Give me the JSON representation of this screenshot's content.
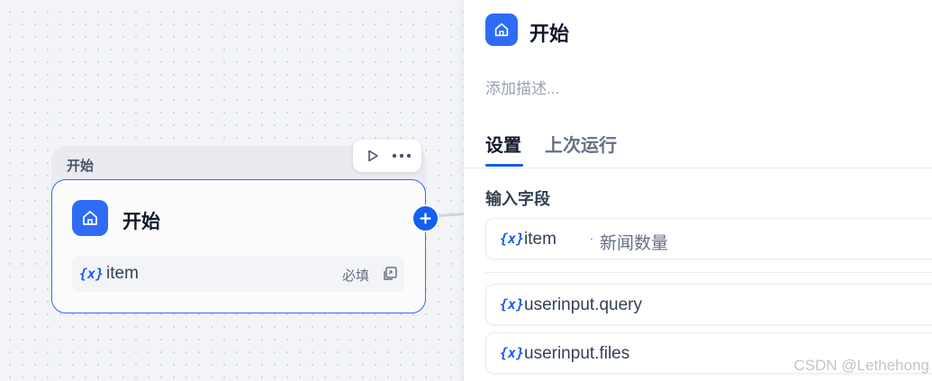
{
  "canvas": {
    "node_group": {
      "title": "开始"
    },
    "toolbar": {
      "run_icon": "play-icon",
      "more_icon": "more-icon"
    },
    "node": {
      "title": "开始",
      "icon": "home-icon",
      "variable": {
        "glyph": "{x}",
        "name": "item",
        "required_label": "必填",
        "copy_icon": "copy-icon"
      },
      "add_icon": "plus-icon"
    }
  },
  "panel": {
    "icon": "home-icon",
    "title": "开始",
    "description_placeholder": "添加描述...",
    "tabs": [
      {
        "label": "设置",
        "active": true
      },
      {
        "label": "上次运行",
        "active": false
      }
    ],
    "input_fields_title": "输入字段",
    "fields": [
      {
        "glyph": "{x}",
        "name": "item",
        "separator": "·",
        "description": "新闻数量"
      },
      {
        "glyph": "{x}",
        "name": "userinput.query"
      },
      {
        "glyph": "{x}",
        "name": "userinput.files"
      }
    ]
  },
  "watermark": "CSDN @Lethehong",
  "colors": {
    "accent": "#155eef",
    "node_icon_bg": "#2e6cf6",
    "canvas_bg": "#f2f4f7"
  }
}
